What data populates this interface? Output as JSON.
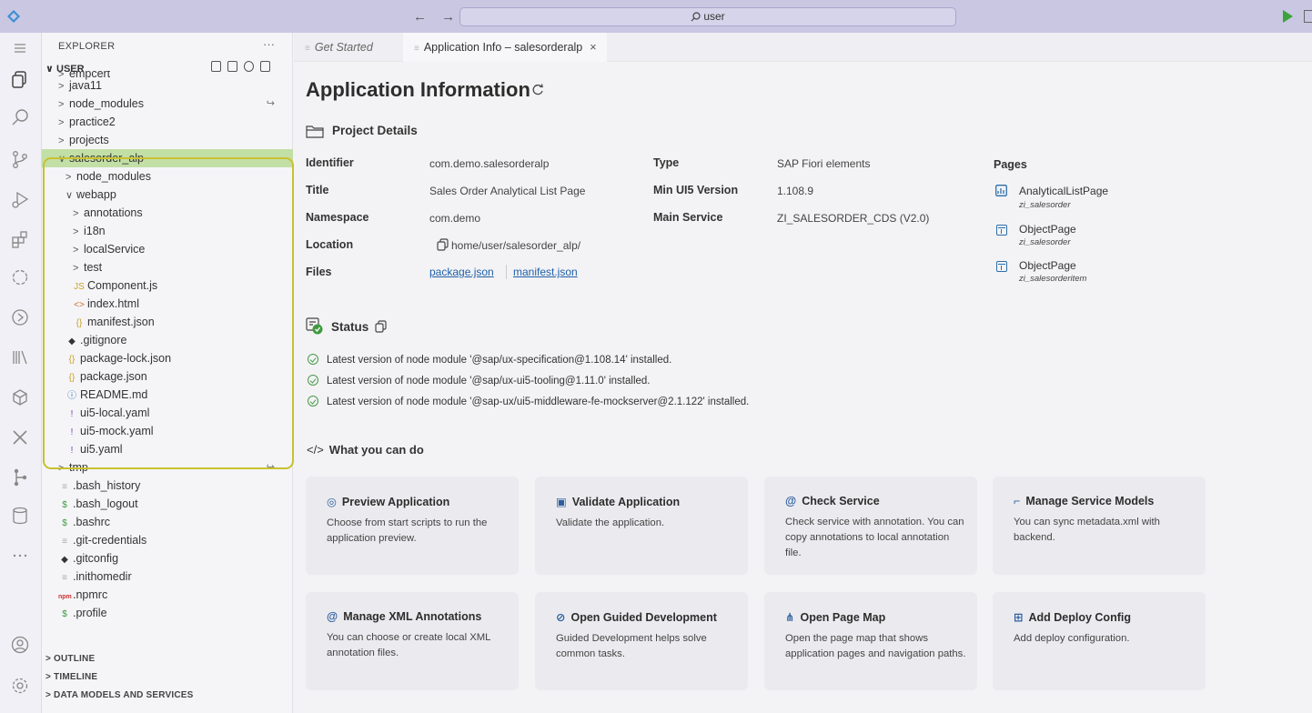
{
  "titlebar": {
    "search": "user"
  },
  "explorer": {
    "title": "EXPLORER",
    "more": "···",
    "root": "USER",
    "rows": [
      {
        "label": "empcert",
        "twisty": ">",
        "indent": 0
      },
      {
        "label": "java11",
        "twisty": ">",
        "indent": 0
      },
      {
        "label": "node_modules",
        "twisty": ">",
        "indent": 0
      },
      {
        "label": "practice2",
        "twisty": ">",
        "indent": 0
      },
      {
        "label": "projects",
        "twisty": ">",
        "indent": 0
      },
      {
        "label": "salesorder_alp",
        "twisty": "∨",
        "indent": 0
      },
      {
        "label": "node_modules",
        "twisty": ">",
        "indent": 1
      },
      {
        "label": "webapp",
        "twisty": "∨",
        "indent": 1
      },
      {
        "label": "annotations",
        "twisty": ">",
        "indent": 2
      },
      {
        "label": "i18n",
        "twisty": ">",
        "indent": 2
      },
      {
        "label": "localService",
        "twisty": ">",
        "indent": 2
      },
      {
        "label": "test",
        "twisty": ">",
        "indent": 2
      },
      {
        "label": "Component.js",
        "icon": "JS",
        "indent": 2
      },
      {
        "label": "index.html",
        "icon": "<>",
        "indent": 2
      },
      {
        "label": "manifest.json",
        "icon": "{}",
        "indent": 2
      },
      {
        "label": ".gitignore",
        "icon": "◆",
        "indent": 1
      },
      {
        "label": "package-lock.json",
        "icon": "{}",
        "indent": 1
      },
      {
        "label": "package.json",
        "icon": "{}",
        "indent": 1
      },
      {
        "label": "README.md",
        "icon": "ⓘ",
        "indent": 1
      },
      {
        "label": "ui5-local.yaml",
        "icon": "!",
        "indent": 1
      },
      {
        "label": "ui5-mock.yaml",
        "icon": "!",
        "indent": 1
      },
      {
        "label": "ui5.yaml",
        "icon": "!",
        "indent": 1
      },
      {
        "label": "tmp",
        "twisty": ">",
        "indent": 0
      },
      {
        "label": ".bash_history",
        "icon": "≡",
        "indent": 0
      },
      {
        "label": ".bash_logout",
        "icon": "$",
        "indent": 0
      },
      {
        "label": ".bashrc",
        "icon": "$",
        "indent": 0
      },
      {
        "label": ".git-credentials",
        "icon": "≡",
        "indent": 0
      },
      {
        "label": ".gitconfig",
        "icon": "◆",
        "indent": 0
      },
      {
        "label": ".inithomedir",
        "icon": "≡",
        "indent": 0
      },
      {
        "label": ".npmrc",
        "icon": "npm",
        "indent": 0
      },
      {
        "label": ".profile",
        "icon": "$",
        "indent": 0
      }
    ],
    "sections": [
      "OUTLINE",
      "TIMELINE",
      "DATA MODELS AND SERVICES"
    ]
  },
  "tabs": [
    {
      "label": "Get Started"
    },
    {
      "label": "Application Info – salesorderalp",
      "close": "×"
    }
  ],
  "page": {
    "title": "Application Information",
    "project_details": {
      "heading": "Project Details",
      "fields": [
        {
          "label": "Identifier",
          "value": "com.demo.salesorderalp"
        },
        {
          "label": "Title",
          "value": "Sales Order Analytical List Page"
        },
        {
          "label": "Namespace",
          "value": "com.demo"
        },
        {
          "label": "Location",
          "value": "home/user/salesorder_alp/"
        },
        {
          "label": "Files",
          "value": ""
        }
      ],
      "files": [
        "package.json",
        "manifest.json"
      ],
      "fields2": [
        {
          "label": "Type",
          "value": "SAP Fiori elements"
        },
        {
          "label": "Min UI5 Version",
          "value": "1.108.9"
        },
        {
          "label": "Main Service",
          "value": "ZI_SALESORDER_CDS (V2.0)"
        }
      ],
      "pages_label": "Pages",
      "pages": [
        {
          "name": "AnalyticalListPage",
          "entity": "zi_salesorder"
        },
        {
          "name": "ObjectPage",
          "entity": "zi_salesorder"
        },
        {
          "name": "ObjectPage",
          "entity": "zi_salesorderitem"
        }
      ]
    },
    "status": {
      "heading": "Status",
      "lines": [
        "Latest version of node module '@sap/ux-specification@1.108.14' installed.",
        "Latest version of node module '@sap/ux-ui5-tooling@1.11.0' installed.",
        "Latest version of node module '@sap-ux/ui5-middleware-fe-mockserver@2.1.122' installed."
      ]
    },
    "actions_heading_icon": "</>",
    "actions_heading": "What you can do",
    "cards": [
      {
        "icon": "◎",
        "title": "Preview Application",
        "desc": "Choose from start scripts to run the application preview."
      },
      {
        "icon": "▣",
        "title": "Validate Application",
        "desc": "Validate the application."
      },
      {
        "icon": "@",
        "title": "Check Service",
        "desc": "Check service with annotation. You can copy annotations to local annotation file."
      },
      {
        "icon": "⌐",
        "title": "Manage Service Models",
        "desc": "You can sync metadata.xml with backend."
      },
      {
        "icon": "@",
        "title": "Manage XML Annotations",
        "desc": "You can choose or create local XML annotation files."
      },
      {
        "icon": "⊘",
        "title": "Open Guided Development",
        "desc": "Guided Development helps solve common tasks."
      },
      {
        "icon": "⋔",
        "title": "Open Page Map",
        "desc": "Open the page map that shows application pages and navigation paths."
      },
      {
        "icon": "⊞",
        "title": "Add Deploy Config",
        "desc": "Add deploy configuration."
      }
    ]
  }
}
